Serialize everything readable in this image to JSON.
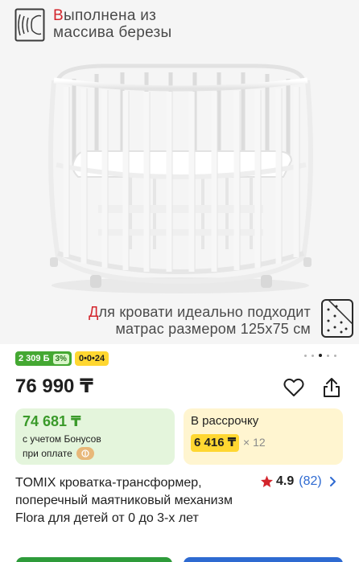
{
  "hero": {
    "caption_highlight": "В",
    "caption_line1_rest": "ыполнена из",
    "caption_line2": "массива березы",
    "mattress_highlight": "Д",
    "mattress_line1_rest": "ля кровати идеально подходит",
    "mattress_line2": "матрас размером 125х75 см"
  },
  "badges": {
    "bonus": "2 309 Б",
    "bonus_percent": "3%",
    "installment": "0•0•24"
  },
  "price": "76 990 ₸",
  "bonus_card": {
    "price": "74 681 ₸",
    "line1": "с учетом Бонусов",
    "line2": "при оплате"
  },
  "installment_card": {
    "label": "В рассрочку",
    "amount": "6 416 ₸",
    "multiplier": "× 12"
  },
  "product": {
    "title": "TOMIX кроватка-трансформер, поперечный маятниковый механизм Flora для детей от 0 до 3-х лет",
    "rating": "4.9",
    "reviews": "(82)"
  },
  "colors": {
    "accent_red": "#d3252c",
    "bonus_green": "#44a832",
    "installment_yellow": "#ffd731",
    "link_blue": "#2e6ad1"
  }
}
